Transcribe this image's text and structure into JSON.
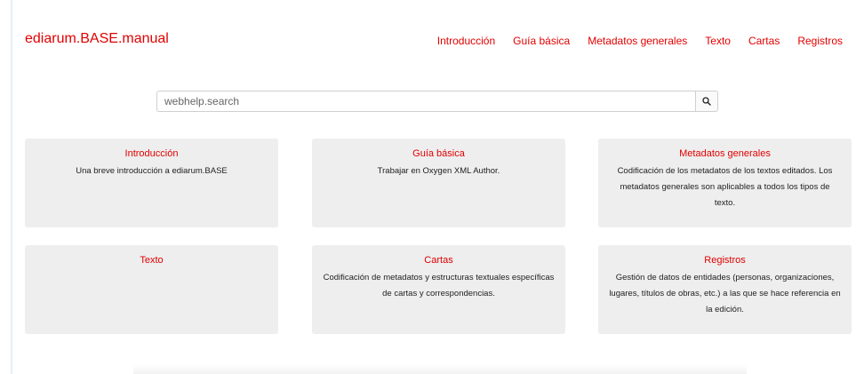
{
  "header": {
    "brand": "ediarum.BASE.manual",
    "nav": [
      {
        "label": "Introducción"
      },
      {
        "label": "Guía básica"
      },
      {
        "label": "Metadatos generales"
      },
      {
        "label": "Texto"
      },
      {
        "label": "Cartas"
      },
      {
        "label": "Registros"
      }
    ]
  },
  "search": {
    "placeholder": "webhelp.search",
    "button_icon": "search-icon"
  },
  "cards": [
    {
      "title": "Introducción",
      "description": "Una breve introducción a ediarum.BASE"
    },
    {
      "title": "Guía básica",
      "description": "Trabajar en Oxygen XML Author."
    },
    {
      "title": "Metadatos generales",
      "description": "Codificación de los metadatos de los textos editados. Los metadatos generales son aplicables a todos los tipos de texto."
    },
    {
      "title": "Texto",
      "description": ""
    },
    {
      "title": "Cartas",
      "description": "Codificación de metadatos y estructuras textuales específicas de cartas y correspondencias."
    },
    {
      "title": "Registros",
      "description": "Gestión de datos de entidades (personas, organizaciones, lugares, títulos de obras, etc.) a las que se hace referencia en la edición."
    }
  ],
  "colors": {
    "accent": "#e10000",
    "card_background": "#eeeeee"
  }
}
